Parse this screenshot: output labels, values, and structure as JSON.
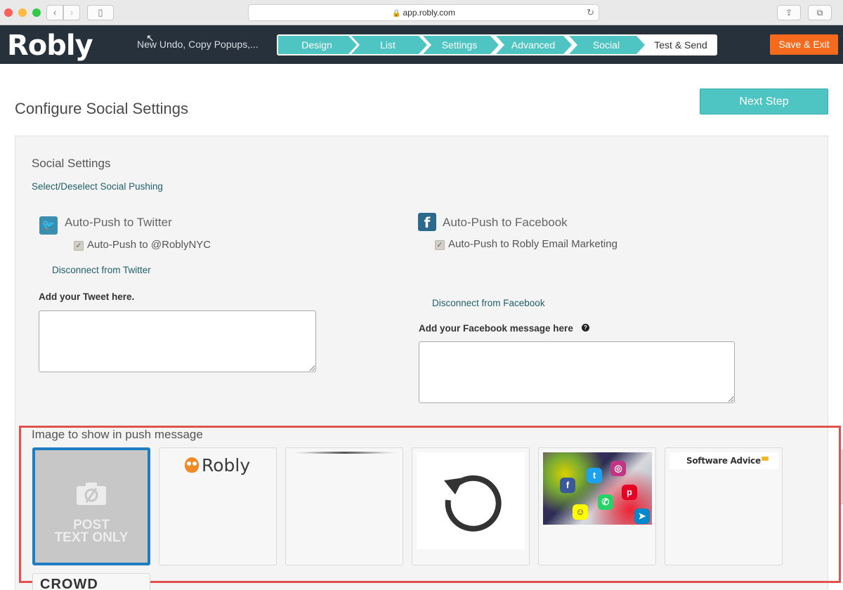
{
  "browser": {
    "url": "app.robly.com",
    "lock_icon": "lock-icon",
    "reload_icon": "reload-icon"
  },
  "header": {
    "logo": "Robly",
    "campaign_name": "New Undo, Copy Popups,...",
    "steps": [
      {
        "label": "Design"
      },
      {
        "label": "List"
      },
      {
        "label": "Settings"
      },
      {
        "label": "Advanced"
      },
      {
        "label": "Social"
      },
      {
        "label": "Test & Send"
      }
    ],
    "save_exit_label": "Save & Exit"
  },
  "page": {
    "title": "Configure Social Settings",
    "next_step_label": "Next Step"
  },
  "social": {
    "section_title": "Social Settings",
    "select_deselect_link": "Select/Deselect Social Pushing",
    "twitter": {
      "heading": "Auto-Push to Twitter",
      "checkbox_label": "Auto-Push to @RoblyNYC",
      "checked": true,
      "disconnect_link": "Disconnect from Twitter",
      "field_label": "Add your Tweet here.",
      "value": ""
    },
    "facebook": {
      "heading": "Auto-Push to Facebook",
      "checkbox_label": "Auto-Push to Robly Email Marketing",
      "checked": true,
      "disconnect_link": "Disconnect from Facebook",
      "field_label": "Add your Facebook message here",
      "value": ""
    }
  },
  "images": {
    "title": "Image to show in push message",
    "no_image_line1": "POST",
    "no_image_line2": "TEXT ONLY",
    "robly_label": "Robly",
    "software_advice_label": "Software Advice",
    "crowd_label": "CROWD"
  },
  "colors": {
    "header_bg": "#27313b",
    "accent_teal": "#4fc5c3",
    "save_orange": "#f56a1c",
    "highlight_red": "#e0524b",
    "selected_blue": "#1f7ec1"
  }
}
